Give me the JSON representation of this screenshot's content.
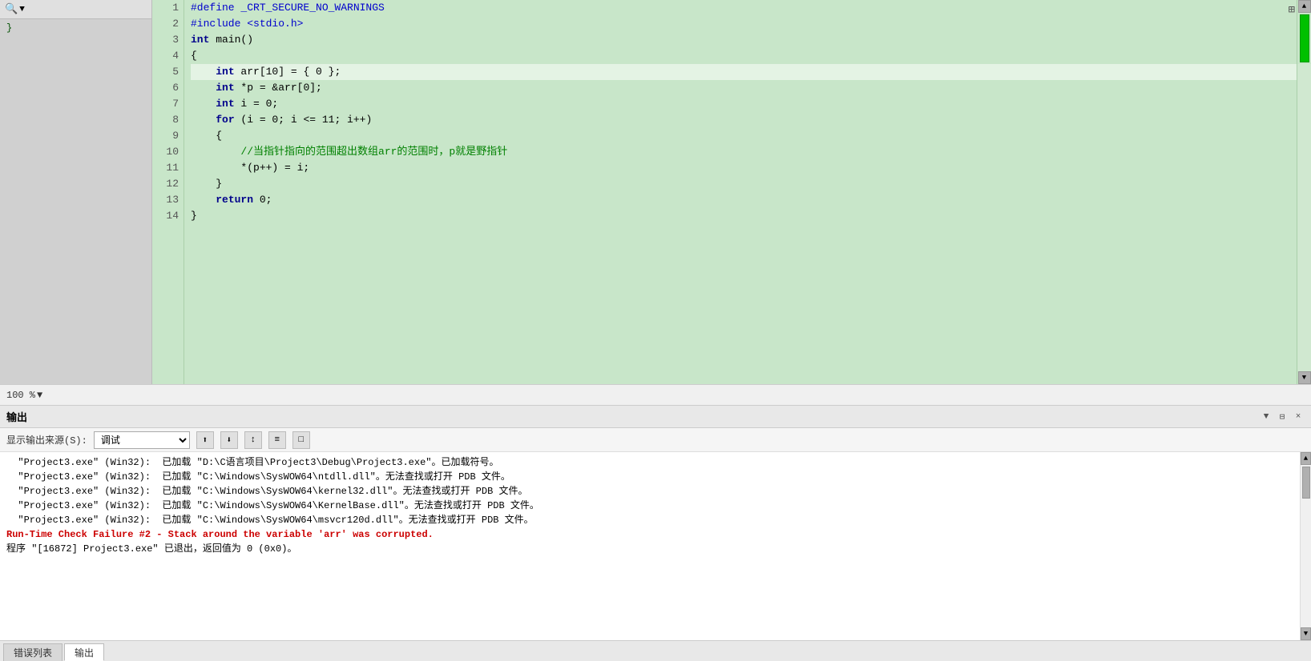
{
  "code": {
    "lines": [
      {
        "num": 1,
        "content": "#define _CRT_SECURE_NO_WARNINGS",
        "type": "preprocessor"
      },
      {
        "num": 2,
        "content": "#include <stdio.h>",
        "type": "preprocessor"
      },
      {
        "num": 3,
        "content": "int main()",
        "type": "normal"
      },
      {
        "num": 4,
        "content": "{",
        "type": "normal"
      },
      {
        "num": 5,
        "content": "    int arr[10] = { 0 };",
        "type": "highlight"
      },
      {
        "num": 6,
        "content": "    int *p = &arr[0];",
        "type": "normal"
      },
      {
        "num": 7,
        "content": "    int i = 0;",
        "type": "normal"
      },
      {
        "num": 8,
        "content": "    for (i = 0; i <= 11; i++)",
        "type": "normal"
      },
      {
        "num": 9,
        "content": "    {",
        "type": "normal"
      },
      {
        "num": 10,
        "content": "        //当指针指向的范围超出数组arr的范围时，p就是野指针",
        "type": "comment"
      },
      {
        "num": 11,
        "content": "        *(p++) = i;",
        "type": "normal"
      },
      {
        "num": 12,
        "content": "    }",
        "type": "normal"
      },
      {
        "num": 13,
        "content": "    return 0;",
        "type": "normal"
      },
      {
        "num": 14,
        "content": "}",
        "type": "normal"
      }
    ]
  },
  "zoom": {
    "level": "100 %",
    "dropdown_arrow": "▼"
  },
  "output_panel": {
    "title": "输出",
    "source_label": "显示输出来源(S):",
    "source_value": "调试",
    "toolbar_buttons": [
      "↑",
      "↓",
      "↕",
      "≡",
      "□"
    ]
  },
  "output_content": {
    "lines": [
      {
        "text": "  \"Project3.exe\" (Win32):  已加载 \"D:\\C语言项目\\Project3\\Debug\\Project3.exe\"。已加载符号。",
        "class": ""
      },
      {
        "text": "  \"Project3.exe\" (Win32):  已加载 \"C:\\Windows\\SysWOW64\\ntdll.dll\"。无法查找或打开 PDB 文件。",
        "class": ""
      },
      {
        "text": "  \"Project3.exe\" (Win32):  已加载 \"C:\\Windows\\SysWOW64\\kernel32.dll\"。无法查找或打开 PDB 文件。",
        "class": ""
      },
      {
        "text": "  \"Project3.exe\" (Win32):  已加载 \"C:\\Windows\\SysWOW64\\KernelBase.dll\"。无法查找或打开 PDB 文件。",
        "class": ""
      },
      {
        "text": "  \"Project3.exe\" (Win32):  已加载 \"C:\\Windows\\SysWOW64\\msvcr120d.dll\"。无法查找或打开 PDB 文件。",
        "class": ""
      },
      {
        "text": "Run-Time Check Failure #2 - Stack around the variable 'arr' was corrupted.",
        "class": "runtime-error"
      },
      {
        "text": "",
        "class": ""
      },
      {
        "text": "程序 \"[16872] Project3.exe\" 已退出，返回值为 0 (0x0)。",
        "class": ""
      }
    ]
  },
  "bottom_tabs": [
    {
      "label": "错误列表",
      "active": false
    },
    {
      "label": "输出",
      "active": true
    }
  ],
  "header_icons": {
    "pin": "▼",
    "dock": "⊟",
    "close": "×"
  },
  "top_right_expand": "⊞"
}
